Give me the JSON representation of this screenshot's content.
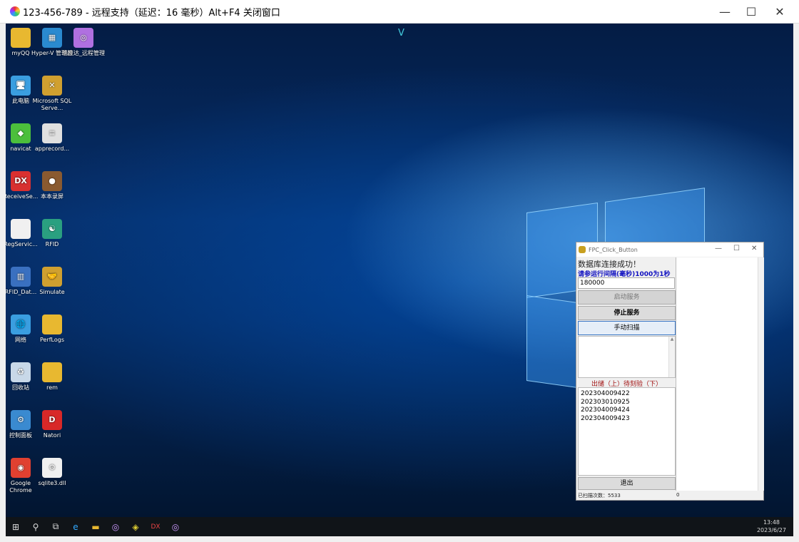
{
  "window": {
    "title": "123-456-789 - 远程支持（延迟：16 毫秒）Alt+F4 关闭窗口",
    "minimize": "—",
    "maximize": "☐",
    "close": "✕"
  },
  "desktop": {
    "top_marker": "V",
    "icons": [
      {
        "label": "myQQ",
        "icon": "folder-icon",
        "color": "#e8b830",
        "glyph": ""
      },
      {
        "label": "Hyper-V 管理器",
        "icon": "hyperv-icon",
        "color": "#2a8ad0",
        "glyph": "▦"
      },
      {
        "label": "皓应达_远程管理",
        "icon": "remote-support-icon",
        "color": "#b070e0",
        "glyph": "◎"
      },
      {
        "label": "此电脑",
        "icon": "computer-icon",
        "color": "#3a9ee0",
        "glyph": "🖥"
      },
      {
        "label": "Microsoft SQL Serve...",
        "icon": "sql-server-icon",
        "color": "#d0a030",
        "glyph": "✕"
      },
      {
        "label": "navicat",
        "icon": "navicat-icon",
        "color": "#4cbf3c",
        "glyph": "◆"
      },
      {
        "label": "apprecord...",
        "icon": "document-icon",
        "color": "#e0e0e0",
        "glyph": "≡"
      },
      {
        "label": "ReceiveSe...",
        "icon": "dx-icon",
        "color": "#d83030",
        "glyph": "DX"
      },
      {
        "label": "本本录屏",
        "icon": "recorder-icon",
        "color": "#8a5a30",
        "glyph": "●"
      },
      {
        "label": "RegServic...",
        "icon": "file-icon",
        "color": "#f0f0f0",
        "glyph": ""
      },
      {
        "label": "RFID",
        "icon": "rfid-icon",
        "color": "#2aa080",
        "glyph": "☯"
      },
      {
        "label": "RFID_Dat...",
        "icon": "rfid-data-icon",
        "color": "#3a70c0",
        "glyph": "▥"
      },
      {
        "label": "Simulate",
        "icon": "handshake-icon",
        "color": "#d0a030",
        "glyph": "🤝"
      },
      {
        "label": "网络",
        "icon": "network-icon",
        "color": "#3a9ee0",
        "glyph": "🌐"
      },
      {
        "label": "PerfLogs",
        "icon": "folder-icon",
        "color": "#e8b830",
        "glyph": ""
      },
      {
        "label": "回收站",
        "icon": "recycle-bin-icon",
        "color": "#c8d8e8",
        "glyph": "♻"
      },
      {
        "label": "rem",
        "icon": "folder-icon",
        "color": "#e8b830",
        "glyph": ""
      },
      {
        "label": "控制面板",
        "icon": "control-panel-icon",
        "color": "#3a8ad0",
        "glyph": "⚙"
      },
      {
        "label": "Natori",
        "icon": "natori-icon",
        "color": "#d82828",
        "glyph": "D"
      },
      {
        "label": "Google Chrome",
        "icon": "chrome-icon",
        "color": "#e04030",
        "glyph": "◉"
      },
      {
        "label": "sqlite3.dll",
        "icon": "dll-icon",
        "color": "#f0f0f0",
        "glyph": "⚙"
      }
    ]
  },
  "taskbar": {
    "start": "⊞",
    "search": "⚲",
    "taskview": "⧉",
    "apps": [
      "e",
      "▬",
      "◎",
      "◈",
      "DX",
      "◎"
    ],
    "time": "13:48",
    "date": "2023/6/27"
  },
  "app": {
    "title": "FPC_Click_Button",
    "status_db": "数据库连接成功！",
    "interval_label": "请参运行间隔(毫秒)1000为1秒",
    "interval_value": "180000",
    "start_label": "启动服务",
    "stop_label": "停止服务",
    "scan_label": "手动扫描",
    "list_header": "出储（上）待刻验（下）",
    "list_items": [
      "202304009422",
      "202303010925",
      "202304009424",
      "202304009423"
    ],
    "exit_label": "退出",
    "scan_count_label": "已扫描次数：5533",
    "right_status": "0"
  }
}
